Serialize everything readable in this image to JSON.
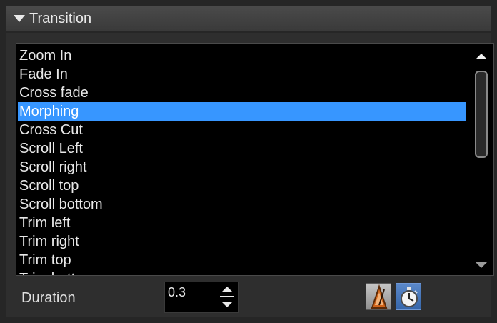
{
  "panel": {
    "title": "Transition"
  },
  "list": {
    "items": [
      "Zoom In",
      "Fade In",
      "Cross fade",
      "Morphing",
      "Cross Cut",
      "Scroll Left",
      "Scroll right",
      "Scroll top",
      "Scroll bottom",
      "Trim left",
      "Trim right",
      "Trim top",
      "Trim bottom"
    ],
    "selected": "Morphing"
  },
  "duration": {
    "label": "Duration",
    "value": "0.3"
  },
  "icons": {
    "collapse": "triangle-down-icon",
    "scroll_up": "arrow-up-icon",
    "scroll_down": "arrow-down-icon",
    "spin_up": "arrow-up-icon",
    "spin_down": "arrow-down-icon",
    "metronome": "metronome-icon",
    "timer": "stopwatch-icon"
  },
  "colors": {
    "selection": "#3796ff",
    "timer_button": "#3566aa",
    "metronome_button": "#c6c6c6"
  }
}
